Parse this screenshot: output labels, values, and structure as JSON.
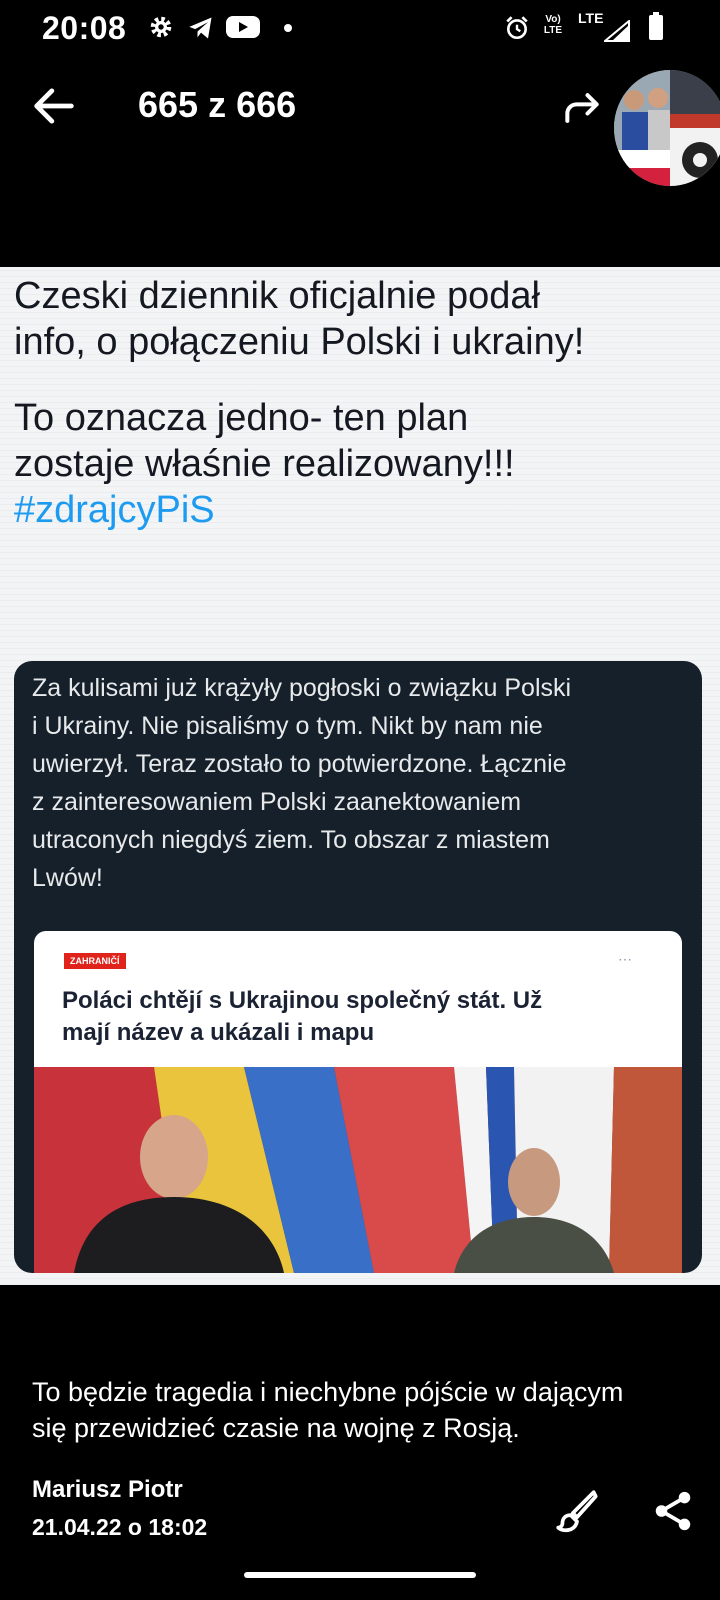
{
  "status_bar": {
    "time": "20:08",
    "icons": [
      "gear-icon",
      "telegram-icon",
      "youtube-icon",
      "notification-dot",
      "alarm-icon",
      "volte-icon",
      "lte-icon",
      "signal-icon",
      "battery-icon"
    ],
    "volte_label": "Vo) LTE",
    "lte_label": "LTE"
  },
  "app_bar": {
    "counter": "665 z 666",
    "back_icon": "arrow-back-icon",
    "forward_icon": "forward-icon"
  },
  "photo": {
    "post_line1": "Czeski dziennik oficjalnie podał",
    "post_line2": "info, o połączeniu Polski i ukrainy!",
    "post_line3": "To oznacza jedno- ten plan",
    "post_line4": "zostaje właśnie realizowany!!!",
    "hashtag": "#zdrajcyPiS",
    "quote_lines": [
      "Za kulisami już krążyły pogłoski o związku Polski",
      "i Ukrainy. Nie pisaliśmy o tym. Nikt by nam nie",
      "uwierzył. Teraz zostało to potwierdzone. Łącznie",
      "z zainteresowaniem Polski zaanektowaniem",
      "utraconych niegdyś ziem. To obszar z miastem",
      "Lwów!"
    ],
    "article_tag": "ZAHRANIČÍ",
    "article_headline_line1": "Poláci chtějí s Ukrajinou společný stát. Už",
    "article_headline_line2": "mají název a ukázali i mapu",
    "colors": {
      "card_bg": "#15202b",
      "hashtag": "#1d9bf0",
      "tag_red": "#e0241b"
    }
  },
  "caption": {
    "line1": "To będzie tragedia i niechybne pójście w dającym",
    "line2": "się przewidzieć czasie na wojnę z Rosją."
  },
  "author": "Mariusz Piotr",
  "date": "21.04.22 o 18:02",
  "actions": {
    "edit_icon": "brush-icon",
    "share_icon": "share-icon"
  }
}
